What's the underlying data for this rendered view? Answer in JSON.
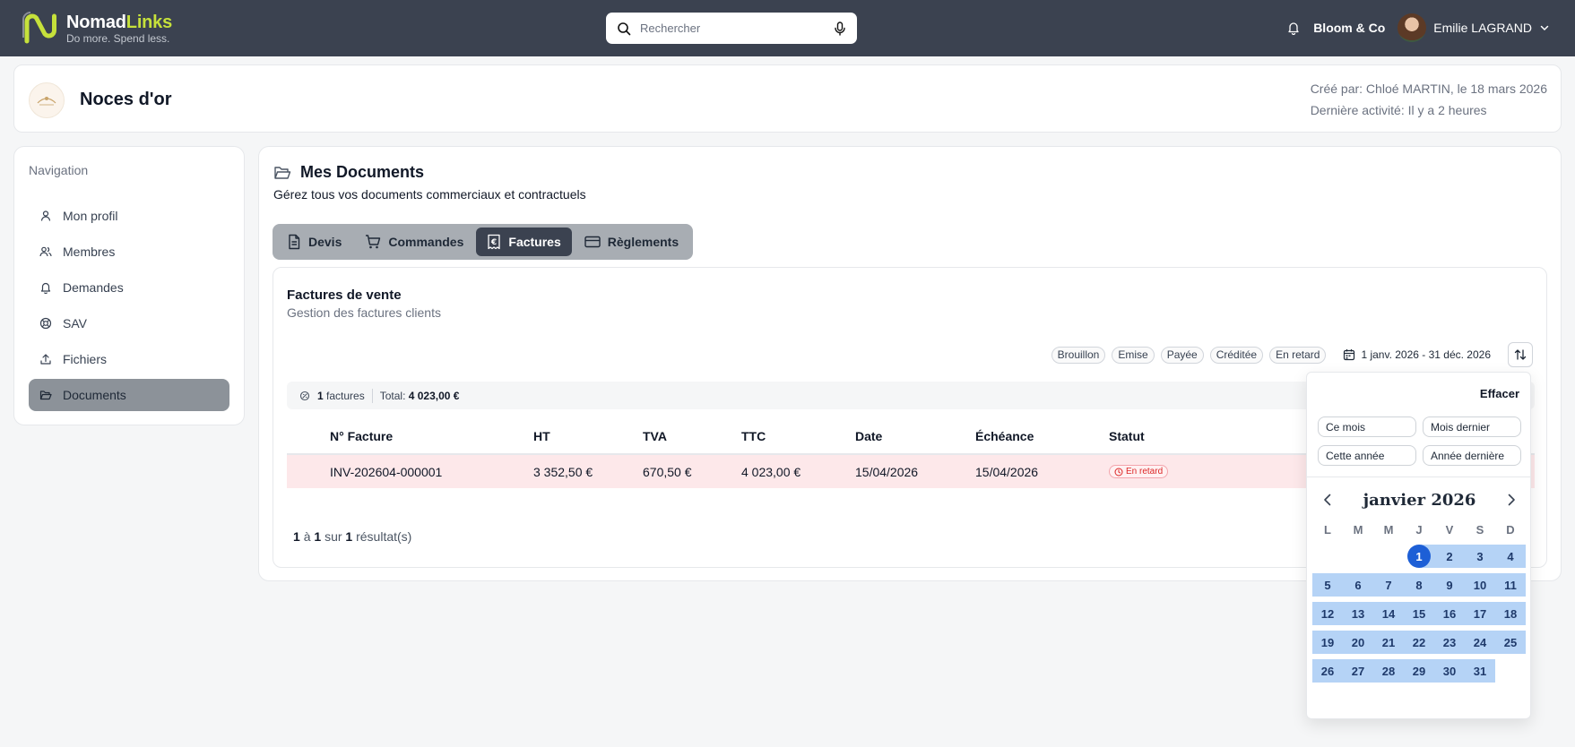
{
  "app": {
    "brand_first": "Nomad",
    "brand_second": "Links",
    "tagline": "Do more. Spend less.",
    "search_placeholder": "Rechercher",
    "organization": "Bloom & Co",
    "user_name": "Emilie LAGRAND"
  },
  "project": {
    "title": "Noces d'or",
    "created_by": "Créé par: Chloé MARTIN, le 18 mars 2026",
    "last_activity": "Dernière activité: Il y a 2 heures"
  },
  "sidebar": {
    "title": "Navigation",
    "items": [
      {
        "label": "Mon profil",
        "icon": "user-icon"
      },
      {
        "label": "Membres",
        "icon": "users-icon"
      },
      {
        "label": "Demandes",
        "icon": "bell-icon"
      },
      {
        "label": "SAV",
        "icon": "lifebuoy-icon"
      },
      {
        "label": "Fichiers",
        "icon": "upload-icon"
      },
      {
        "label": "Documents",
        "icon": "folder-icon",
        "active": true
      }
    ]
  },
  "documents": {
    "title": "Mes Documents",
    "subtitle": "Gérez tous vos documents commerciaux et contractuels",
    "tabs": [
      {
        "label": "Devis",
        "icon": "file-icon"
      },
      {
        "label": "Commandes",
        "icon": "cart-icon"
      },
      {
        "label": "Factures",
        "icon": "euro-receipt-icon",
        "active": true
      },
      {
        "label": "Règlements",
        "icon": "credit-card-icon"
      }
    ]
  },
  "invoices": {
    "title": "Factures de vente",
    "subtitle": "Gestion des factures clients",
    "filters": [
      "Brouillon",
      "Emise",
      "Payée",
      "Créditée",
      "En retard"
    ],
    "date_range": "1 janv. 2026 - 31 déc. 2026",
    "summary_count": "1",
    "summary_count_label": "factures",
    "summary_total_label": "Total:",
    "summary_total": "4 023,00 €",
    "columns": [
      "N° Facture",
      "HT",
      "TVA",
      "TTC",
      "Date",
      "Échéance",
      "Statut"
    ],
    "rows": [
      {
        "number": "INV-202604-000001",
        "ht": "3 352,50 €",
        "tva": "670,50 €",
        "ttc": "4 023,00 €",
        "date": "15/04/2026",
        "due": "15/04/2026",
        "status": "En retard"
      }
    ],
    "pagination": {
      "from": "1",
      "to_label": "à",
      "to": "1",
      "of_label": "sur",
      "total": "1",
      "results_label": "résultat(s)"
    }
  },
  "datepicker": {
    "clear_label": "Effacer",
    "presets": [
      "Ce mois",
      "Mois dernier",
      "Cette année",
      "Année dernière"
    ],
    "month_label": "janvier 2026",
    "weekdays": [
      "L",
      "M",
      "M",
      "J",
      "V",
      "S",
      "D"
    ],
    "weeks": [
      [
        "",
        "",
        "",
        "1",
        "2",
        "3",
        "4"
      ],
      [
        "5",
        "6",
        "7",
        "8",
        "9",
        "10",
        "11"
      ],
      [
        "12",
        "13",
        "14",
        "15",
        "16",
        "17",
        "18"
      ],
      [
        "19",
        "20",
        "21",
        "22",
        "23",
        "24",
        "25"
      ],
      [
        "26",
        "27",
        "28",
        "29",
        "30",
        "31",
        ""
      ]
    ],
    "selected_day": "1"
  },
  "colors": {
    "topbar": "#3b4250",
    "brand_accent": "#c6e13b",
    "late_row": "#fde8ea",
    "range_fill": "#b5d3f6",
    "selected_day": "#1d5fd6"
  }
}
